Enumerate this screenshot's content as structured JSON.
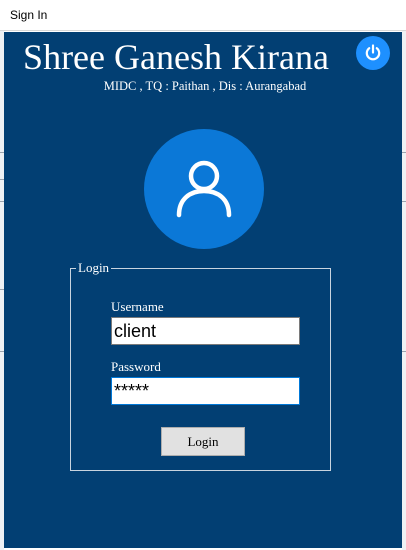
{
  "window": {
    "title": "Sign In"
  },
  "header": {
    "shop_name": "Shree Ganesh Kirana",
    "address": "MIDC , TQ : Paithan , Dis : Aurangabad"
  },
  "icons": {
    "power": "power-icon",
    "avatar": "user-icon"
  },
  "login": {
    "group_title": "Login",
    "username_label": "Username",
    "username_value": "client",
    "password_label": "Password",
    "password_value": "*****",
    "button_label": "Login"
  },
  "colors": {
    "background": "#023f73",
    "accent": "#1e90ff",
    "avatar_bg": "#0b78d7"
  }
}
